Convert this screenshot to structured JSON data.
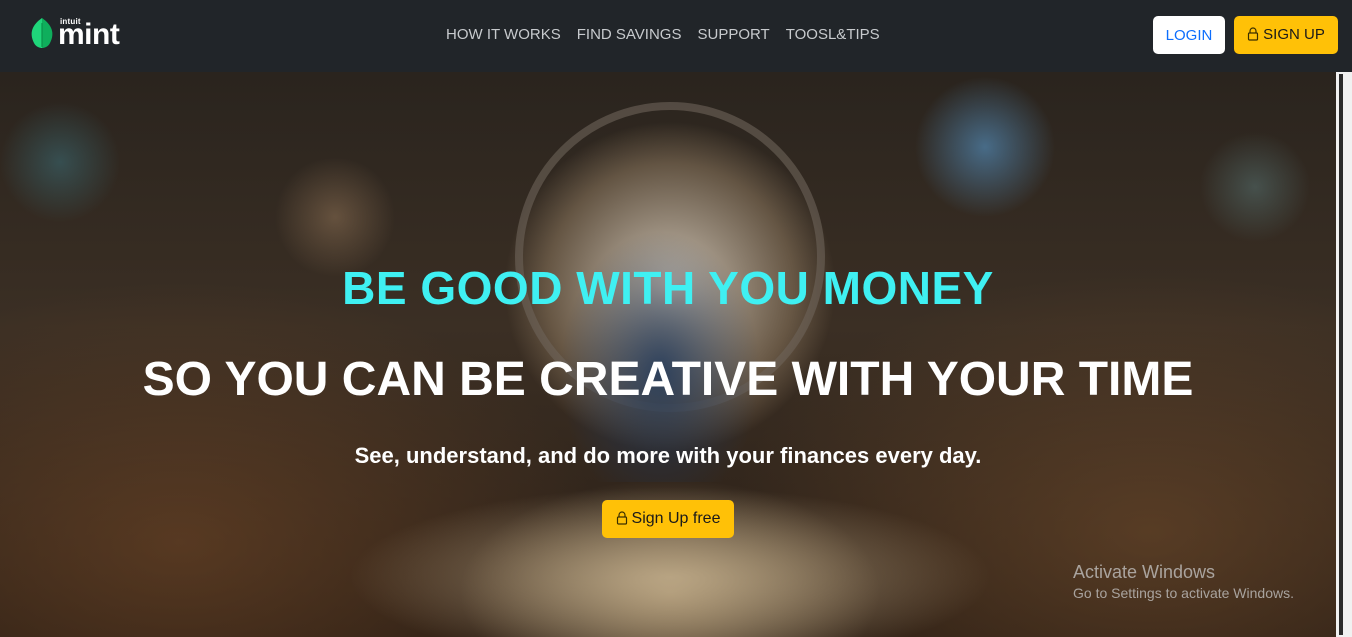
{
  "navbar": {
    "brand": {
      "small_text": "intuit",
      "name": "mint"
    },
    "links": [
      {
        "label": "HOW IT WORKS"
      },
      {
        "label": "FIND SAVINGS"
      },
      {
        "label": "SUPPORT"
      },
      {
        "label": "TOOSL&TIPS"
      }
    ],
    "login_label": "LOGIN",
    "signup_label": "SIGN UP",
    "signup_icon": "lock-icon"
  },
  "hero": {
    "title": "BE GOOD WITH YOU MONEY",
    "subtitle": "SO YOU CAN BE CREATIVE WITH YOUR TIME",
    "tagline": "See, understand, and do more with your finances every day.",
    "cta_label": "Sign Up free",
    "cta_icon": "lock-icon"
  },
  "watermark": {
    "line1": "Activate Windows",
    "line2": "Go to Settings to activate Windows."
  },
  "colors": {
    "navbar_bg": "#212529",
    "accent_yellow": "#ffc107",
    "title_cyan": "#3ff0f2",
    "login_text": "#0d6efd"
  }
}
